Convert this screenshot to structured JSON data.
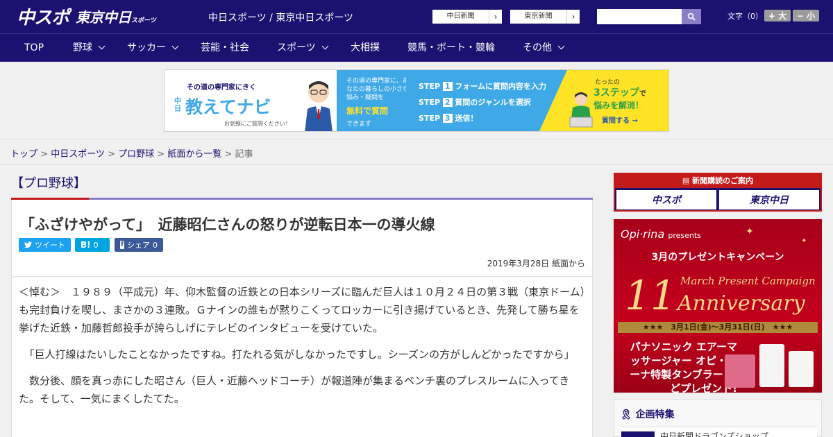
{
  "header": {
    "logo_main": "中スポ",
    "logo_sub": "東京中日",
    "logo_sub_small": "スポーツ",
    "site_title": "中日スポーツ / 東京中日スポーツ",
    "link_chunichi": "中日新聞",
    "link_tokyo": "東京新聞",
    "font_size_label": "文字（0）",
    "font_larger": "+ 大",
    "font_smaller": "− 小"
  },
  "nav": {
    "items": [
      "TOP",
      "野球",
      "サッカー",
      "芸能・社会",
      "スポーツ",
      "大相撲",
      "競馬・ボート・競輪",
      "その他"
    ]
  },
  "banner": {
    "tagline": "その道の専門家にきく",
    "brand_prefix": "中日",
    "brand": "教えてナビ",
    "sub": "お気軽にご質問ください！",
    "mid_text": "その道の専門家に、あなたの暮らしの小さな悩み・疑問を",
    "mid_highlight": "無料で質問",
    "mid_end": "できます",
    "step1": "フォームに質問内容を入力",
    "step2": "質問のジャンルを選択",
    "step3": "送信！",
    "step_label": "STEP",
    "right_top": "たったの",
    "right_big": "3ステップ",
    "right_mid": "で",
    "right_bottom": "悩みを解消！",
    "cta": "質問する"
  },
  "breadcrumb": {
    "home": "トップ",
    "site": "中日スポーツ",
    "section": "プロ野球",
    "list": "紙面から一覧",
    "current": "記事",
    "sep": ">"
  },
  "article": {
    "category": "【プロ野球】",
    "headline": "「ふざけやがって」　近藤昭仁さんの怒りが逆転日本一の導火線",
    "share_tweet": "ツイート",
    "share_hatena": "B!",
    "share_hatena_count": "0",
    "share_fb": "シェア",
    "share_fb_count": "0",
    "date": "2019年3月28日 紙面から",
    "paragraphs": [
      "＜悼む＞　１９８９（平成元）年、仰木監督の近鉄との日本シリーズに臨んだ巨人は１０月２４日の第３戦（東京ドーム）も完封負けを喫し、まさかの３連敗。Ｇナインの誰もが黙りこくってロッカーに引き揚げているとき、先発して勝ち星を挙げた近鉄・加藤哲郎投手が誇らしげにテレビのインタビューを受けていた。",
      "　「巨人打線はたいしたことなかったですね。打たれる気がしなかったですし。シーズンの方がしんどかったですから」",
      "　数分後、顔を真っ赤にした昭さん（巨人・近藤ヘッドコーチ）が報道陣が集まるベンチ裏のプレスルームに入ってきた。そして、一気にまくしたてた。"
    ]
  },
  "sidebar": {
    "subscribe_head": "新聞購読のご案内",
    "sub_btn1": "中スポ",
    "sub_btn2": "東京中日",
    "promo_brand": "Opi·rina",
    "promo_presents": "presents",
    "promo_campaign": "3月のプレゼントキャンペーン",
    "promo_num": "11",
    "promo_en": "March Present Campaign",
    "promo_anniv": "Anniversary",
    "promo_period": "★★★　3月1日(金)〜3月31日(日)　★★★",
    "promo_prod": "パナソニック エアーマッサージャー オピ・リーナ特製タンブラー などプレゼント!",
    "feature_title": "企画特集",
    "feature_item": "中日新聞ドラゴンズショップ"
  },
  "colors": {
    "brand_navy": "#1a1170",
    "accent_red": "#c31a1a",
    "accent_purple": "#8a7fc7",
    "twitter_blue": "#1da1f2",
    "hatena_blue": "#00a4de",
    "facebook_blue": "#3b5998"
  }
}
